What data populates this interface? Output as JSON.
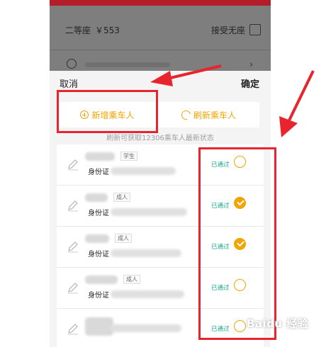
{
  "background": {
    "seat_type": "二等座",
    "seat_price": "￥553",
    "accept_no_seat": "接受无座"
  },
  "sheet": {
    "cancel_label": "取消",
    "confirm_label": "确定",
    "add_passenger_label": "新增乘车人",
    "refresh_passenger_label": "刷新乘车人",
    "hint": "刷新可获取12306乘车人最新状态"
  },
  "passengers": [
    {
      "tag": "学生",
      "id_label": "身份证",
      "status": "已通过",
      "checked": false
    },
    {
      "tag": "成人",
      "id_label": "身份证",
      "status": "已通过",
      "checked": true
    },
    {
      "tag": "成人",
      "id_label": "身份证",
      "status": "已通过",
      "checked": true
    },
    {
      "tag": "成人",
      "id_label": "身份证",
      "status": "已通过",
      "checked": false
    },
    {
      "tag": "",
      "id_label": "",
      "status": "已通过",
      "checked": false
    }
  ],
  "watermark": "Baidu 经验",
  "colors": {
    "accent": "#f2a400",
    "status": "#14a88c",
    "annotation": "#e8242d",
    "brand_bar": "#b41e2a"
  },
  "icons": [
    "plus-circle-icon",
    "refresh-icon",
    "pencil-icon",
    "check-circle-icon",
    "bulb-icon",
    "chevron-right-icon"
  ]
}
